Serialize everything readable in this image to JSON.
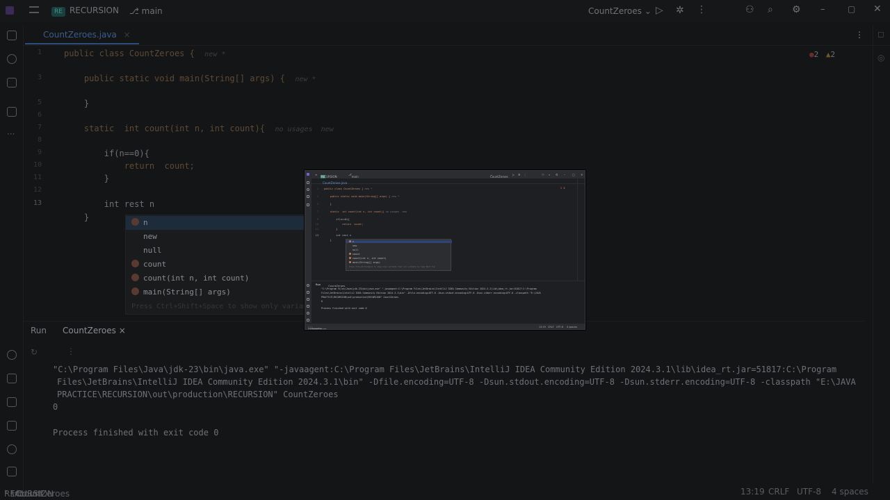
{
  "app": {
    "project_badge": "RE",
    "project_name": "RECURSION",
    "branch": "main",
    "run_config": "CountZeroes",
    "file_tab": "CountZeroes.java"
  },
  "editor": {
    "inspections": {
      "errors": "2",
      "warnings": "2"
    },
    "lines": [
      {
        "num": "1",
        "text": "public class CountZeroes {",
        "hint": "new *"
      },
      {
        "num": "",
        "text": ""
      },
      {
        "num": "3",
        "text": "    public static void main(String[] args) {",
        "hint": "new *"
      },
      {
        "num": "",
        "text": ""
      },
      {
        "num": "5",
        "text": "    }"
      },
      {
        "num": "6",
        "text": ""
      },
      {
        "num": "7",
        "text": "    static  int count(int n, int count){",
        "hint": "no usages  new"
      },
      {
        "num": "8",
        "text": ""
      },
      {
        "num": "9",
        "text": "        if(n==0){"
      },
      {
        "num": "10",
        "text": "            return  count;"
      },
      {
        "num": "11",
        "text": "        }"
      },
      {
        "num": "12",
        "text": ""
      },
      {
        "num": "13",
        "text": "        int rest n"
      },
      {
        "num": "14",
        "text": "    }"
      }
    ],
    "completion": {
      "items": [
        "n",
        "new",
        "null",
        "count",
        "count(int n, int count)",
        "main(String[] args)"
      ],
      "footer": "Press Ctrl+Shift+Space to show only variants that are suitable by type",
      "mini_footer": "Press Ctrl+Shift+Space to show only variants that are suitable by type Next Tip"
    }
  },
  "run_panel": {
    "title": "Run",
    "tab": "CountZeroes",
    "console": [
      "\"C:\\Program Files\\Java\\jdk-23\\bin\\java.exe\" \"-javaagent:C:\\Program Files\\JetBrains\\IntelliJ IDEA Community Edition 2024.3.1\\lib\\idea_rt.jar=51817:C:\\Program",
      "Files\\JetBrains\\IntelliJ IDEA Community Edition 2024.3.1\\bin\" -Dfile.encoding=UTF-8 -Dsun.stdout.encoding=UTF-8 -Dsun.stderr.encoding=UTF-8 -classpath \"E:\\JAVA",
      "PRACTICE\\RECURSION\\out\\production\\RECURSION\" CountZeroes",
      "0",
      "",
      "Process finished with exit code 0"
    ]
  },
  "status_bar": {
    "breadcrumbs": [
      "RECURSION",
      "src",
      "CountZeroes",
      "count"
    ],
    "position": "13:19",
    "line_sep": "CRLF",
    "encoding": "UTF-8",
    "indent": "4 spaces"
  }
}
